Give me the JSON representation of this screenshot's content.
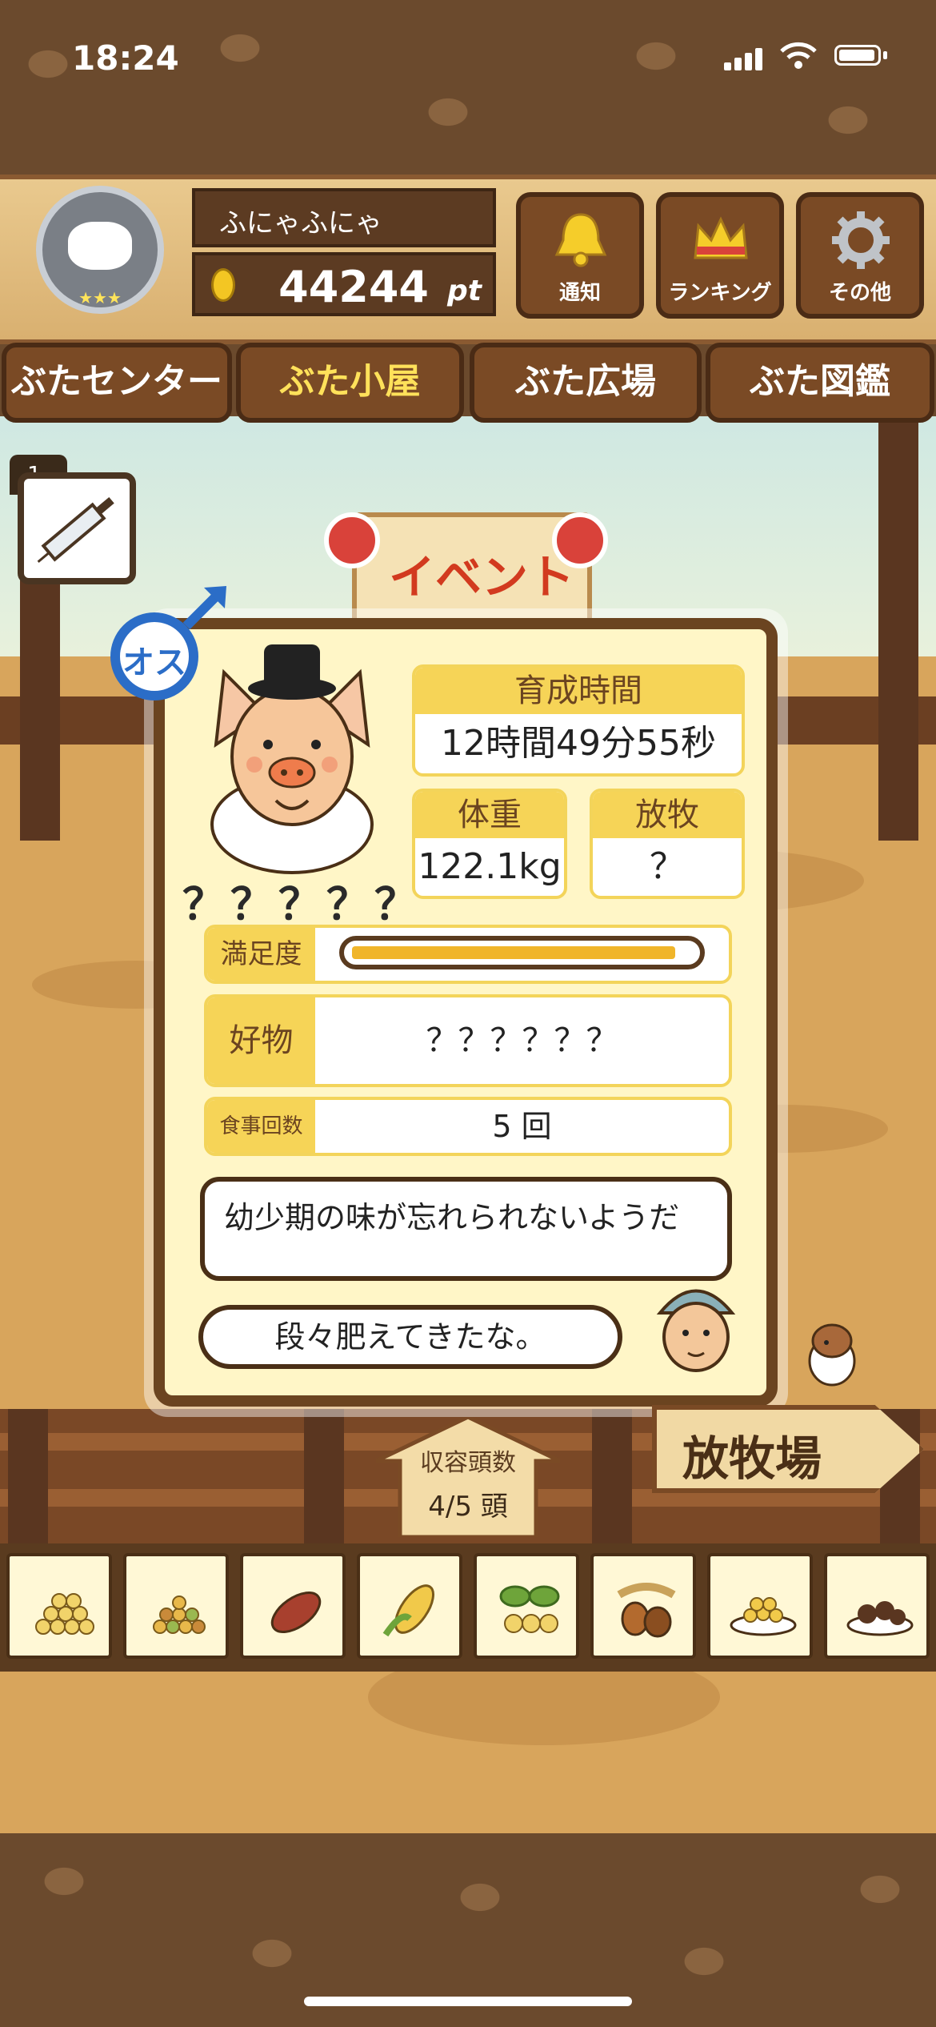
{
  "status": {
    "time": "18:24"
  },
  "player": {
    "name": "ふにゃふにゃ",
    "points": "44244",
    "points_unit": "pt"
  },
  "header_buttons": [
    {
      "label": "通知",
      "icon": "bell-icon"
    },
    {
      "label": "ランキング",
      "icon": "crown-icon"
    },
    {
      "label": "その他",
      "icon": "gear-icon"
    }
  ],
  "tabs": [
    {
      "label": "ぶたセンター",
      "active": false
    },
    {
      "label": "ぶた小屋",
      "active": true
    },
    {
      "label": "ぶた広場",
      "active": false
    },
    {
      "label": "ぶた図鑑",
      "active": false
    }
  ],
  "syringe": {
    "count": "1"
  },
  "event_sign": {
    "label": "イベント"
  },
  "pig": {
    "gender": "オス",
    "name_unknown": "？？？？？",
    "stats": {
      "raise_time_label": "育成時間",
      "raise_time": "12時間49分55秒",
      "weight_label": "体重",
      "weight": "122.1kg",
      "grazing_label": "放牧",
      "grazing": "？"
    },
    "satisfaction_label": "満足度",
    "satisfaction": 0.95,
    "favorite_label": "好物",
    "favorite": "？？？？？？",
    "meals_label": "食事回数",
    "meals": "5 回",
    "comment": "幼少期の味が忘れられないようだ",
    "farmer_comment": "段々肥えてきたな。"
  },
  "capacity": {
    "label": "収容頭数",
    "value": "4/5 頭"
  },
  "pasture_sign": {
    "label": "放牧場"
  },
  "foods": [
    "grains-icon",
    "mixed-grains-icon",
    "sweet-potato-icon",
    "corn-icon",
    "soybean-icon",
    "acorn-icon",
    "grain-bowl-icon",
    "chestnut-plate-icon"
  ],
  "colors": {
    "panel_bg": "#fff6c7",
    "accent_yellow": "#f6d457",
    "wood_dark": "#6b4420",
    "male_blue": "#2b6dc7"
  }
}
